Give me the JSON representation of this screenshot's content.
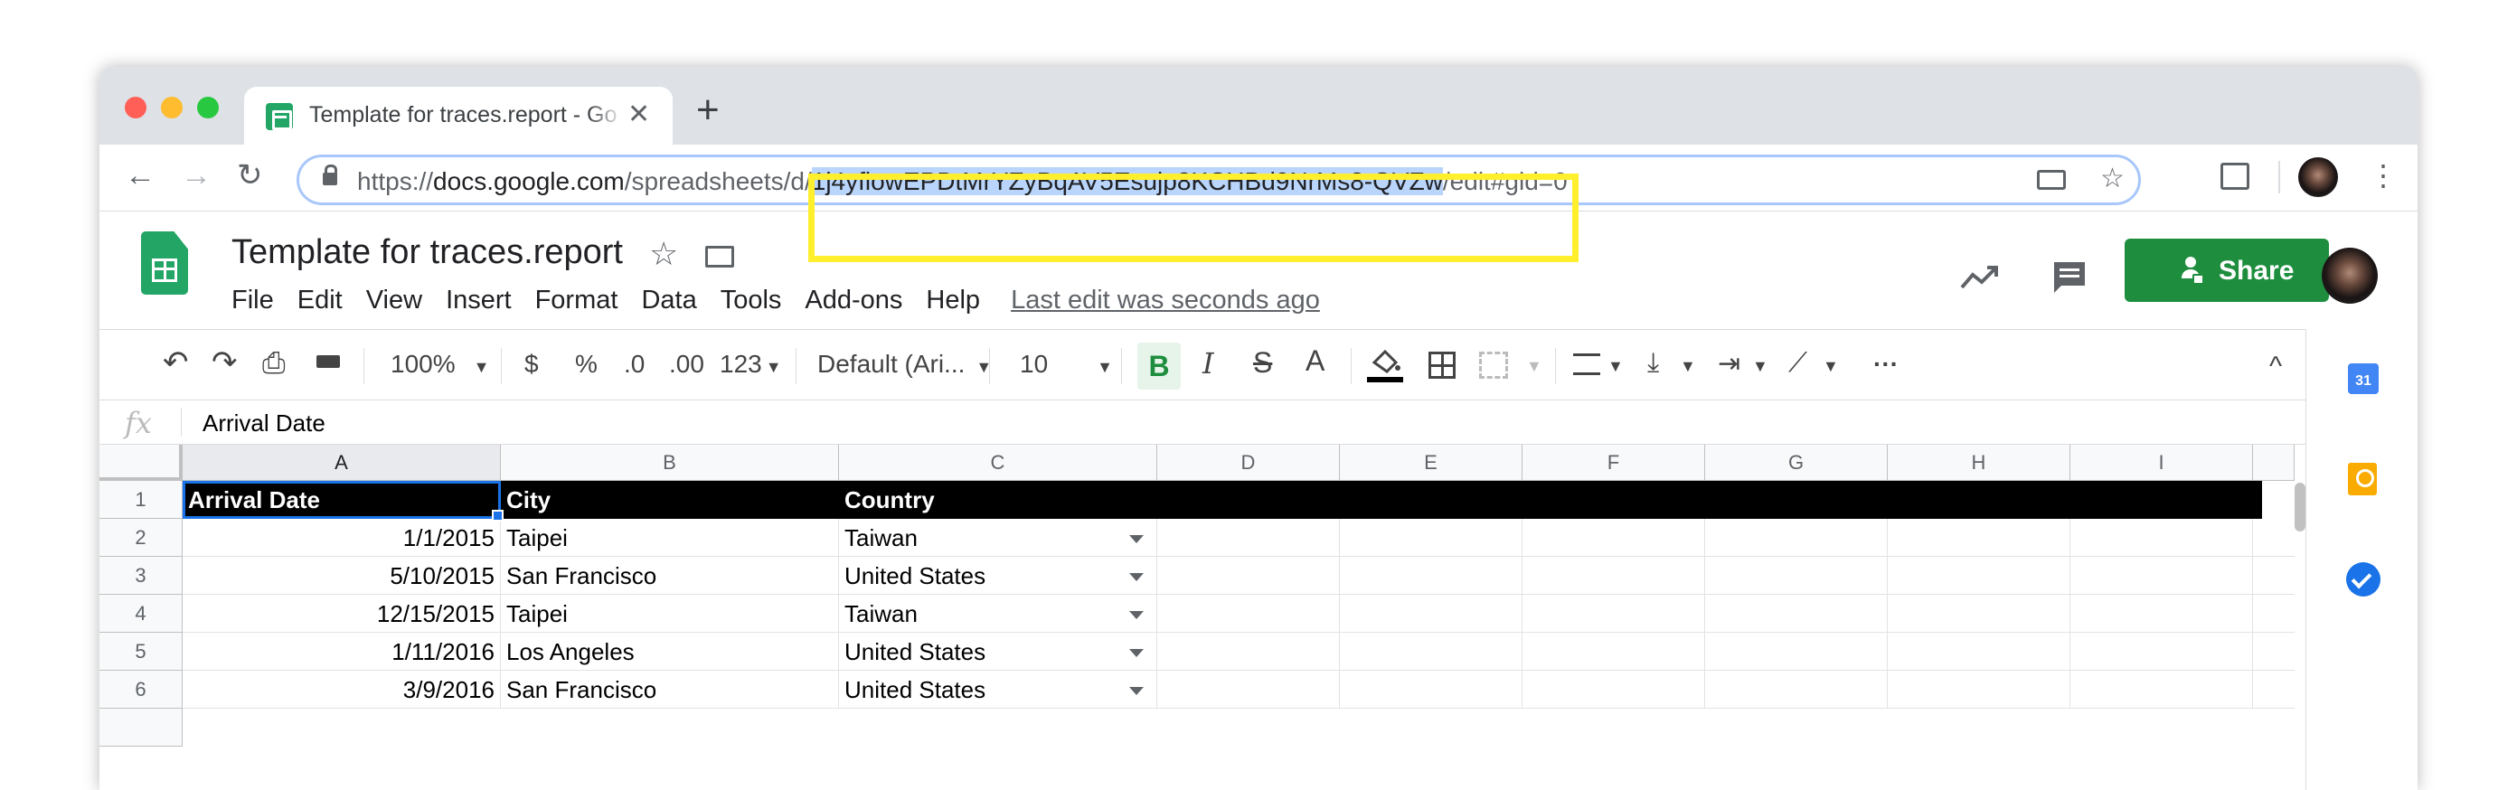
{
  "browser": {
    "tab_title": "Template for traces.report - Google Sheets",
    "tab_close": "✕",
    "new_tab": "+",
    "url_prefix": "https://",
    "url_host": "docs.google.com",
    "url_path1": "/spreadsheets/d/",
    "url_id": "1j4yfiowEPDtMrYZyBqAV5Esujp8KCHBd9NrMs8-QVZw",
    "url_path2": "/edit#gid=0",
    "back": "←",
    "forward": "→",
    "reload": "↻",
    "star": "☆",
    "menu": "⋮"
  },
  "doc": {
    "title": "Template for traces.report",
    "star": "☆",
    "move": "⧉",
    "menu": [
      "File",
      "Edit",
      "View",
      "Insert",
      "Format",
      "Data",
      "Tools",
      "Add-ons",
      "Help"
    ],
    "last_edit": "Last edit was seconds ago",
    "share": "Share"
  },
  "format_toolbar": {
    "undo": "↶",
    "redo": "↷",
    "print": "⎙",
    "paint": "🖌",
    "zoom": "100%",
    "currency": "$",
    "percent": "%",
    "dec_less": ".0",
    "dec_more": ".00",
    "more_formats": "123",
    "font": "Default (Ari...",
    "font_size": "10",
    "bold": "B",
    "italic": "I",
    "strike": "S",
    "text_color": "A",
    "more": "···",
    "collapse": "^"
  },
  "formula_bar": {
    "fx": "fx",
    "value": "Arrival Date"
  },
  "columns": [
    "A",
    "B",
    "C",
    "D",
    "E",
    "F",
    "G",
    "H",
    "I"
  ],
  "rows": [
    {
      "n": "1",
      "a": "Arrival Date",
      "b": "City",
      "c": "Country"
    },
    {
      "n": "2",
      "a": "1/1/2015",
      "b": "Taipei",
      "c": "Taiwan"
    },
    {
      "n": "3",
      "a": "5/10/2015",
      "b": "San Francisco",
      "c": "United States"
    },
    {
      "n": "4",
      "a": "12/15/2015",
      "b": "Taipei",
      "c": "Taiwan"
    },
    {
      "n": "5",
      "a": "1/11/2016",
      "b": "Los Angeles",
      "c": "United States"
    },
    {
      "n": "6",
      "a": "3/9/2016",
      "b": "San Francisco",
      "c": "United States"
    }
  ],
  "side_panel": {
    "calendar": "31"
  },
  "colors": {
    "accent": "#1a73e8",
    "share": "#1e8e3e",
    "highlight": "#ffef2c",
    "header_row": "#000000"
  }
}
